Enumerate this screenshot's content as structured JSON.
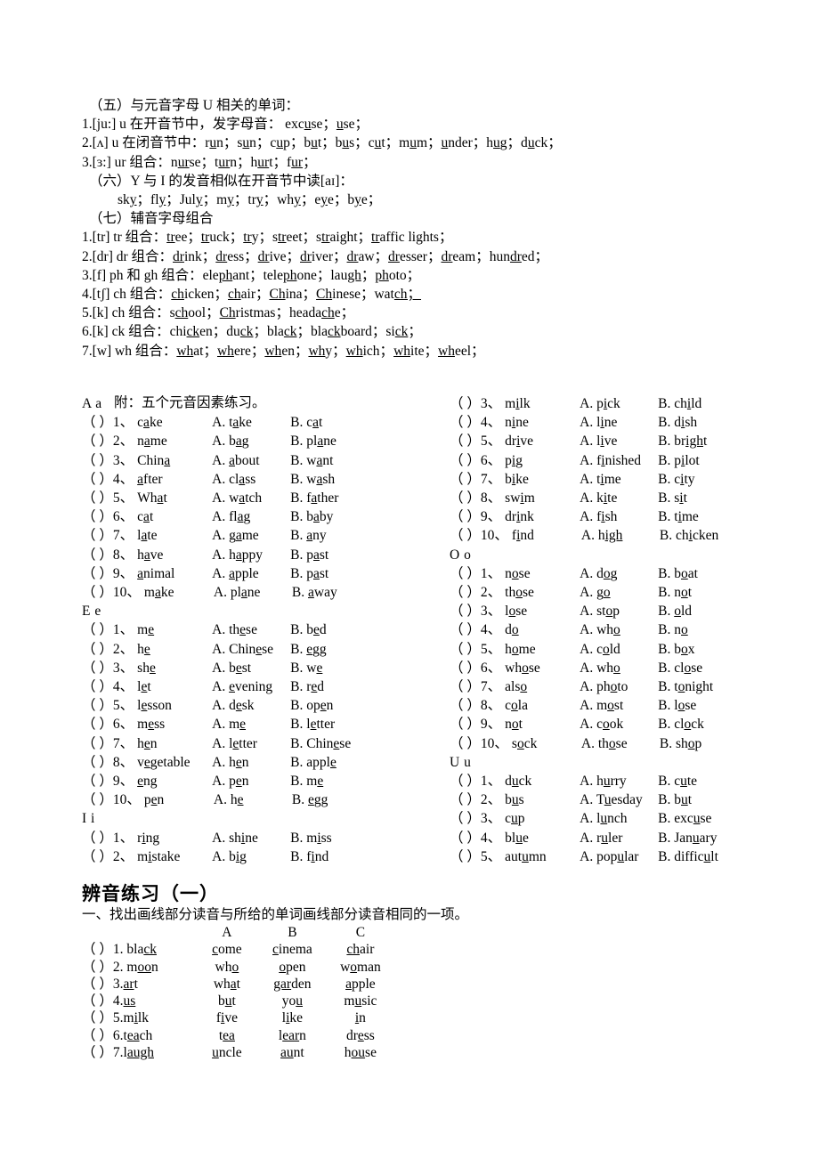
{
  "rules": {
    "lines": [
      {
        "indent": 1,
        "html": "（五）与元音字母 U 相关的单词："
      },
      {
        "indent": 0,
        "html": "1.[ju:]  u 在开音节中，发字母音： exc<u>u</u>se；<u>u</u>se；"
      },
      {
        "indent": 0,
        "html": "2.[ʌ] u 在闭音节中：r<u>u</u>n；s<u>u</u>n；c<u>u</u>p；b<u>u</u>t；b<u>u</u>s；c<u>u</u>t；m<u>u</u>m；<u>u</u>nder；h<u>u</u>g；d<u>u</u>ck；"
      },
      {
        "indent": 0,
        "html": "3.[ɜ:] ur 组合：n<u>ur</u>se；t<u>ur</u>n；h<u>ur</u>t；f<u>ur</u>；"
      },
      {
        "indent": 1,
        "html": "（六）Y 与 I 的发音相似在开音节中读[aɪ]："
      },
      {
        "indent": 2,
        "html": "sk<u>y</u>；fl<u>y</u>；Jul<u>y</u>；m<u>y</u>；tr<u>y</u>；wh<u>y</u>；e<u>y</u>e；b<u>y</u>e；"
      },
      {
        "indent": 1,
        "html": "（七）辅音字母组合"
      },
      {
        "indent": 0,
        "html": "1.[tr] tr 组合：<u>tr</u>ee；<u>tr</u>uck；<u>tr</u>y；s<u>tr</u>eet；s<u>tr</u>aight；<u>tr</u>affic lights；"
      },
      {
        "indent": 0,
        "html": "2.[dr] dr 组合：<u>dr</u>ink；<u>dr</u>ess；<u>dr</u>ive；<u>dr</u>iver；<u>dr</u>aw；<u>dr</u>esser；<u>dr</u>eam；hun<u>dr</u>ed；"
      },
      {
        "indent": 0,
        "html": "3.[f] ph 和 gh 组合：ele<u>ph</u>ant；tele<u>ph</u>one；lau<u>gh</u>；<u>ph</u>oto；"
      },
      {
        "indent": 0,
        "html": "4.[tʃ] ch 组合：<u>ch</u>icken；<u>ch</u>air；<u>Ch</u>ina；<u>Ch</u>inese；wat<u>ch；</u>"
      },
      {
        "indent": 0,
        "html": "5.[k] ch 组合：s<u>ch</u>ool；<u>Ch</u>ristmas；heada<u>ch</u>e；"
      },
      {
        "indent": 0,
        "html": "6.[k] ck 组合：chi<u>ck</u>en；du<u>ck</u>；bla<u>ck</u>；bla<u>ck</u>board；si<u>ck</u>；"
      },
      {
        "indent": 0,
        "html": "7.[w] wh 组合：<u>wh</u>at；<u>wh</u>ere；<u>wh</u>en；<u>wh</u>y；<u>wh</u>ich；<u>wh</u>ite；<u>wh</u>eel；"
      }
    ]
  },
  "attach_label": "附：五个元音因素练习。",
  "exercise": {
    "left_sections": [
      {
        "heading": "A a",
        "items": [
          {
            "num": "1",
            "stem": "c<u>a</u>ke",
            "a": "A. t<u>a</u>ke",
            "b": "B. c<u>a</u>t"
          },
          {
            "num": "2",
            "stem": "n<u>a</u>me",
            "a": "A. b<u>a</u>g",
            "b": "B. pl<u>a</u>ne"
          },
          {
            "num": "3",
            "stem": "Chin<u>a</u>",
            "a": "A. <u>a</u>bout",
            "b": "B. w<u>a</u>nt"
          },
          {
            "num": "4",
            "stem": "<u>a</u>fter",
            "a": "A. cl<u>a</u>ss",
            "b": "B. w<u>a</u>sh"
          },
          {
            "num": "5",
            "stem": "Wh<u>a</u>t",
            "a": "A. w<u>a</u>tch",
            "b": "B. f<u>a</u>ther"
          },
          {
            "num": "6",
            "stem": "c<u>a</u>t",
            "a": "A. fl<u>a</u>g",
            "b": "B. b<u>a</u>by"
          },
          {
            "num": "7",
            "stem": "l<u>a</u>te",
            "a": "A. g<u>a</u>me",
            "b": "B. <u>a</u>ny"
          },
          {
            "num": "8",
            "stem": "h<u>a</u>ve",
            "a": "A. h<u>a</u>ppy",
            "b": "B. p<u>a</u>st"
          },
          {
            "num": "9",
            "stem": "<u>a</u>nimal",
            "a": "A. <u>a</u>pple",
            "b": "B. p<u>a</u>st"
          },
          {
            "num": "10",
            "stem": "m<u>a</u>ke",
            "a": "A. pl<u>a</u>ne",
            "b": "B. <u>a</u>way"
          }
        ]
      },
      {
        "heading": "E e",
        "items": [
          {
            "num": "1",
            "stem": "m<u>e</u>",
            "a": "A. th<u>e</u>se",
            "b": "B. b<u>e</u>d"
          },
          {
            "num": "2",
            "stem": "h<u>e</u>",
            "a": "A. Chin<u>e</u>se",
            "b": "B. <u>e</u>gg"
          },
          {
            "num": "3",
            "stem": "sh<u>e</u>",
            "a": "A. b<u>e</u>st",
            "b": "B. w<u>e</u>"
          },
          {
            "num": "4",
            "stem": "l<u>e</u>t",
            "a": "A. <u>e</u>vening",
            "b": "B. r<u>e</u>d"
          },
          {
            "num": "5",
            "stem": "l<u>e</u>sson",
            "a": "A. d<u>e</u>sk",
            "b": "B. op<u>e</u>n"
          },
          {
            "num": "6",
            "stem": "m<u>e</u>ss",
            "a": "A. m<u>e</u>",
            "b": "B. l<u>e</u>tter"
          },
          {
            "num": "7",
            "stem": "h<u>e</u>n",
            "a": "A. l<u>e</u>tter",
            "b": "B. Chin<u>e</u>se"
          },
          {
            "num": "8",
            "stem": "v<u>e</u>getable",
            "a": "A. h<u>e</u>n",
            "b": "B. appl<u>e</u>"
          },
          {
            "num": "9",
            "stem": "<u>e</u>ng",
            "a": "A. p<u>e</u>n",
            "b": "B. m<u>e</u>"
          },
          {
            "num": "10",
            "stem": "p<u>e</u>n",
            "a": "A. h<u>e</u>",
            "b": "B. <u>e</u>gg"
          }
        ]
      },
      {
        "heading": "I i",
        "items": [
          {
            "num": "1",
            "stem": "r<u>i</u>ng",
            "a": "A. sh<u>i</u>ne",
            "b": "B. m<u>i</u>ss"
          },
          {
            "num": "2",
            "stem": "m<u>i</u>stake",
            "a": "A. b<u>i</u>g",
            "b": "B. f<u>i</u>nd"
          }
        ]
      }
    ],
    "right_sections": [
      {
        "heading": "",
        "items": [
          {
            "num": "3",
            "stem": "m<u>i</u>lk",
            "a": "A. p<u>i</u>ck",
            "b": "B. ch<u>i</u>ld"
          },
          {
            "num": "4",
            "stem": "n<u>i</u>ne",
            "a": "A. l<u>i</u>ne",
            "b": "B. d<u>i</u>sh"
          },
          {
            "num": "5",
            "stem": "dr<u>i</u>ve",
            "a": "A. l<u>i</u>ve",
            "b": "B. br<u>igh</u>t"
          },
          {
            "num": "6",
            "stem": "p<u>i</u>g",
            "a": "A. f<u>i</u>nished",
            "b": "B. p<u>i</u>lot"
          },
          {
            "num": "7",
            "stem": "b<u>i</u>ke",
            "a": "A. t<u>i</u>me",
            "b": "B. c<u>i</u>ty"
          },
          {
            "num": "8",
            "stem": "sw<u>i</u>m",
            "a": "A. k<u>i</u>te",
            "b": "B. s<u>i</u>t"
          },
          {
            "num": "9",
            "stem": "dr<u>i</u>nk",
            "a": "A. f<u>i</u>sh",
            "b": "B. t<u>i</u>me"
          },
          {
            "num": "10",
            "stem": "f<u>i</u>nd",
            "a": "A. h<u>igh</u>",
            "b": "B. ch<u>i</u>cken"
          }
        ]
      },
      {
        "heading": "O o",
        "items": [
          {
            "num": "1",
            "stem": "n<u>o</u>se",
            "a": "A. d<u>o</u>g",
            "b": "B. b<u>o</u>at"
          },
          {
            "num": "2",
            "stem": "th<u>o</u>se",
            "a": "A. g<u>o</u>",
            "b": "B. n<u>o</u>t"
          },
          {
            "num": "3",
            "stem": "l<u>o</u>se",
            "a": "A. st<u>o</u>p",
            "b": "B. <u>o</u>ld"
          },
          {
            "num": "4",
            "stem": "d<u>o</u>",
            "a": "A. wh<u>o</u>",
            "b": "B. n<u>o</u>"
          },
          {
            "num": "5",
            "stem": "h<u>o</u>me",
            "a": "A. c<u>o</u>ld",
            "b": "B. b<u>o</u>x"
          },
          {
            "num": "6",
            "stem": "wh<u>o</u>se",
            "a": "A. wh<u>o</u>",
            "b": "B. cl<u>o</u>se"
          },
          {
            "num": "7",
            "stem": "als<u>o</u>",
            "a": "A. ph<u>o</u>to",
            "b": "B. t<u>o</u>night"
          },
          {
            "num": "8",
            "stem": "c<u>o</u>la",
            "a": "A. m<u>o</u>st",
            "b": "B. l<u>o</u>se"
          },
          {
            "num": "9",
            "stem": "n<u>o</u>t",
            "a": "A. c<u>o</u>ok",
            "b": "B. cl<u>o</u>ck"
          },
          {
            "num": "10",
            "stem": "s<u>o</u>ck",
            "a": "A. th<u>o</u>se",
            "b": "B. sh<u>o</u>p"
          }
        ]
      },
      {
        "heading": "U u",
        "items": [
          {
            "num": "1",
            "stem": "d<u>u</u>ck",
            "a": "A. h<u>u</u>rry",
            "b": "B. c<u>u</u>te"
          },
          {
            "num": "2",
            "stem": "b<u>u</u>s",
            "a": "A. T<u>u</u>esday",
            "b": "B. b<u>u</u>t"
          },
          {
            "num": "3",
            "stem": "c<u>u</u>p",
            "a": "A. l<u>u</u>nch",
            "b": "B. exc<u>u</u>se"
          },
          {
            "num": "4",
            "stem": "bl<u>u</u>e",
            "a": "A. r<u>u</u>ler",
            "b": "B. Jan<u>u</u>ary"
          },
          {
            "num": "5",
            "stem": "aut<u>u</u>mn",
            "a": "A. pop<u>u</u>lar",
            "b": "B. diffic<u>u</u>lt"
          }
        ]
      }
    ]
  },
  "section2": {
    "title": "辨音练习（一）",
    "instruction": "一、找出画线部分读音与所给的单词画线部分读音相同的一项。",
    "headers": [
      "",
      "",
      "A",
      "B",
      "C"
    ],
    "rows": [
      {
        "mark": "（ ）",
        "stem": "1. bla<u>ck</u>",
        "a": "<u>c</u>ome",
        "b": "<u>c</u>inema",
        "c": "<u>ch</u>air"
      },
      {
        "mark": "（ ）",
        "stem": "2. m<u>oo</u>n",
        "a": "wh<u>o</u>",
        "b": "<u>o</u>pen",
        "c": "w<u>o</u>man"
      },
      {
        "mark": "（ ）",
        "stem": "3.<u>ar</u>t",
        "a": "wh<u>a</u>t",
        "b": "<u>gar</u>den",
        "c": "<u>a</u>pple"
      },
      {
        "mark": "（ ）",
        "stem": "4.<u>us</u>",
        "a": "b<u>u</u>t",
        "b": "yo<u>u</u>",
        "c": "m<u>u</u>sic"
      },
      {
        "mark": "（ ）",
        "stem": "5.m<u>i</u>lk",
        "a": "f<u>i</u>ve",
        "b": "l<u>i</u>ke",
        "c": "<u>i</u>n"
      },
      {
        "mark": "（ ）",
        "stem": "6.t<u>ea</u>ch",
        "a": "t<u>ea</u>",
        "b": "l<u>ear</u>n",
        "c": "dr<u>e</u>ss"
      },
      {
        "mark": "（ ）",
        "stem": "7.l<u>augh</u>",
        "a": "<u>u</u>ncle",
        "b": "<u>au</u>nt",
        "c": "h<u>ou</u>se"
      }
    ]
  }
}
